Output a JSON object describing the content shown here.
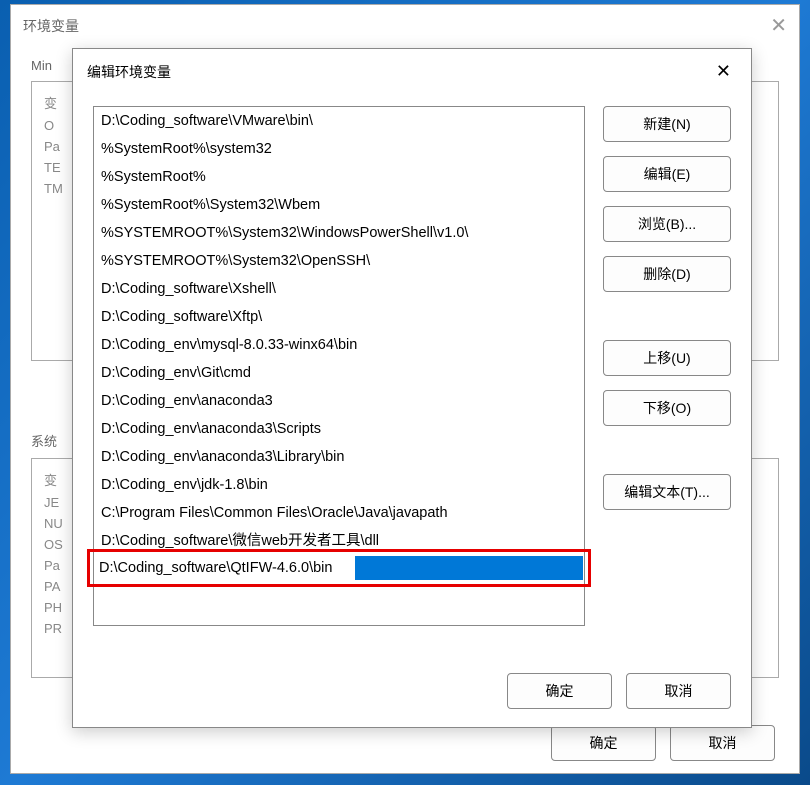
{
  "back_dialog": {
    "title": "环境变量",
    "section1_label": "Min",
    "user_vars_header": "变",
    "user_vars_rows": [
      "O",
      "Pa",
      "TE",
      "TM"
    ],
    "section2_label": "系统",
    "sys_vars_header": "变",
    "sys_vars_rows": [
      "JE",
      "NU",
      "OS",
      "Pa",
      "PA",
      "PH",
      "PR",
      ""
    ],
    "ok": "确定",
    "cancel": "取消"
  },
  "front_dialog": {
    "title": "编辑环境变量",
    "path_entries": [
      "D:\\Coding_software\\VMware\\bin\\",
      "%SystemRoot%\\system32",
      "%SystemRoot%",
      "%SystemRoot%\\System32\\Wbem",
      "%SYSTEMROOT%\\System32\\WindowsPowerShell\\v1.0\\",
      "%SYSTEMROOT%\\System32\\OpenSSH\\",
      "D:\\Coding_software\\Xshell\\",
      "D:\\Coding_software\\Xftp\\",
      "D:\\Coding_env\\mysql-8.0.33-winx64\\bin",
      "D:\\Coding_env\\Git\\cmd",
      "D:\\Coding_env\\anaconda3",
      "D:\\Coding_env\\anaconda3\\Scripts",
      "D:\\Coding_env\\anaconda3\\Library\\bin",
      "D:\\Coding_env\\jdk-1.8\\bin",
      "C:\\Program Files\\Common Files\\Oracle\\Java\\javapath",
      "D:\\Coding_software\\微信web开发者工具\\dll"
    ],
    "editing_entry": "D:\\Coding_software\\QtIFW-4.6.0\\bin",
    "buttons": {
      "new": "新建(N)",
      "edit": "编辑(E)",
      "browse": "浏览(B)...",
      "delete": "删除(D)",
      "moveup": "上移(U)",
      "movedown": "下移(O)",
      "edittext": "编辑文本(T)..."
    },
    "ok": "确定",
    "cancel": "取消"
  }
}
